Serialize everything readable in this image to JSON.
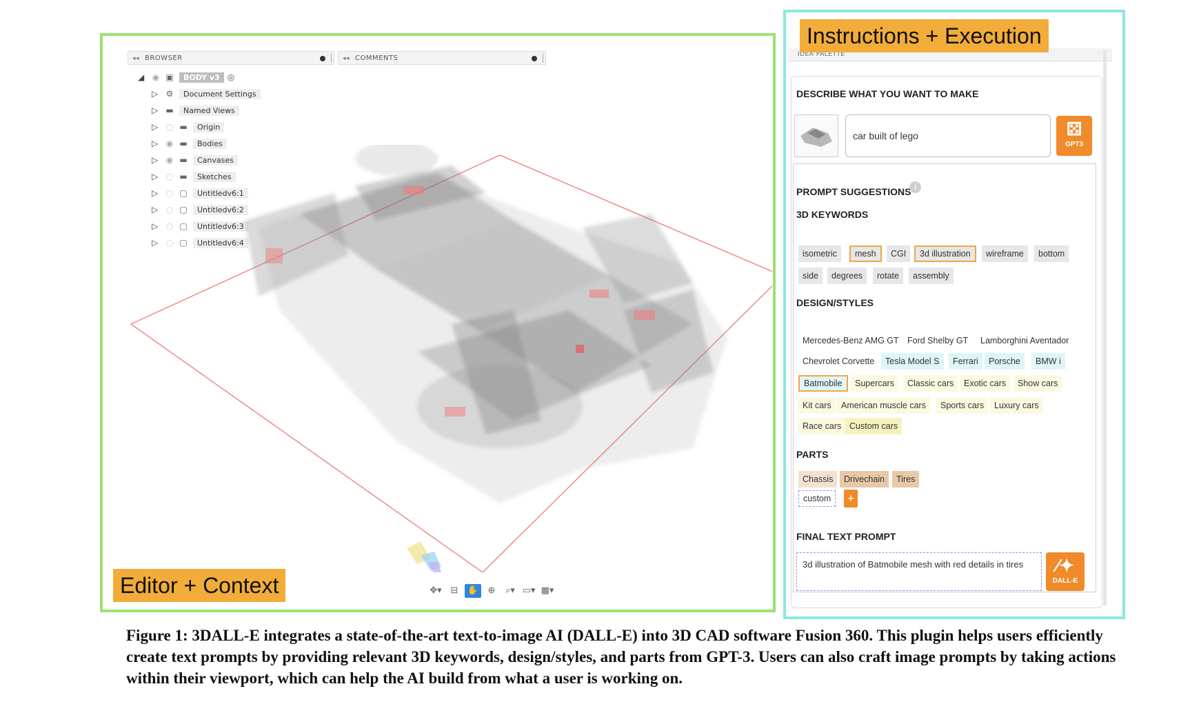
{
  "labels": {
    "instructions": "Instructions + Execution",
    "editor": "Editor + Context"
  },
  "editor": {
    "browser_title": "BROWSER",
    "comments_title": "COMMENTS",
    "tree": [
      {
        "label": "BODY v3",
        "icon": "body-icon"
      },
      {
        "label": "Document Settings",
        "icon": "gear-icon"
      },
      {
        "label": "Named Views",
        "icon": "folder-icon"
      },
      {
        "label": "Origin",
        "icon": "folder-icon"
      },
      {
        "label": "Bodies",
        "icon": "folder-icon"
      },
      {
        "label": "Canvases",
        "icon": "folder-icon"
      },
      {
        "label": "Sketches",
        "icon": "folder-icon"
      },
      {
        "label": "Untitledv6:1",
        "icon": "component-icon"
      },
      {
        "label": "Untitledv6:2",
        "icon": "component-icon"
      },
      {
        "label": "Untitledv6:3",
        "icon": "component-icon"
      },
      {
        "label": "Untitledv6:4",
        "icon": "component-icon"
      }
    ],
    "toolbar": [
      "orbit-icon",
      "look-at-icon",
      "pan-icon",
      "zoom-icon",
      "fit-icon",
      "display-icon",
      "grid-icon"
    ],
    "active_tool": "pan-icon"
  },
  "palette": {
    "header": "IDEA PALETTE",
    "describe_label": "DESCRIBE WHAT YOU WANT TO MAKE",
    "input_value": "car built of lego",
    "gpt3_label": "GPT3",
    "suggestions_label": "PROMPT SUGGESTIONS",
    "keywords_label": "3D KEYWORDS",
    "keywords": [
      "isometric",
      "mesh",
      "CGI",
      "3d illustration",
      "wireframe",
      "bottom",
      "side",
      "degrees",
      "rotate",
      "assembly"
    ],
    "keywords_selected": [
      "mesh",
      "3d illustration"
    ],
    "styles_label": "DESIGN/STYLES",
    "styles": [
      "Mercedes-Benz AMG GT",
      "Ford Shelby GT",
      "Lamborghini Aventador",
      "Chevrolet Corvette",
      "Tesla Model S",
      "Ferrari",
      "Porsche",
      "BMW i",
      "Batmobile",
      "Supercars",
      "Classic cars",
      "Exotic cars",
      "Show cars",
      "Kit cars",
      "American muscle cars",
      "Sports cars",
      "Luxury cars",
      "Race cars",
      "Custom cars"
    ],
    "styles_selected": "Batmobile",
    "parts_label": "PARTS",
    "parts": [
      "Chassis",
      "Drivechain",
      "Tires"
    ],
    "custom_placeholder": "custom",
    "add_label": "+",
    "final_label": "FINAL TEXT PROMPT",
    "final_prompt": "3d illustration of Batmobile mesh with red details in tires",
    "dalle_label": "DALL-E",
    "colors": {
      "accent": "#f08a2a",
      "selected_border": "#f0a643",
      "cyan_chip": "#dff6f6",
      "yellow_chip": "#fbfae0",
      "tan_chip": "#f4e1cf"
    }
  },
  "caption": "Figure 1: 3DALL-E integrates a state-of-the-art text-to-image AI (DALL-E) into 3D CAD software Fusion 360. This plugin helps users efficiently create text prompts by providing relevant 3D keywords, design/styles, and parts from GPT-3. Users can also craft image prompts by taking actions within their viewport, which can help the AI build from what a user is working on."
}
